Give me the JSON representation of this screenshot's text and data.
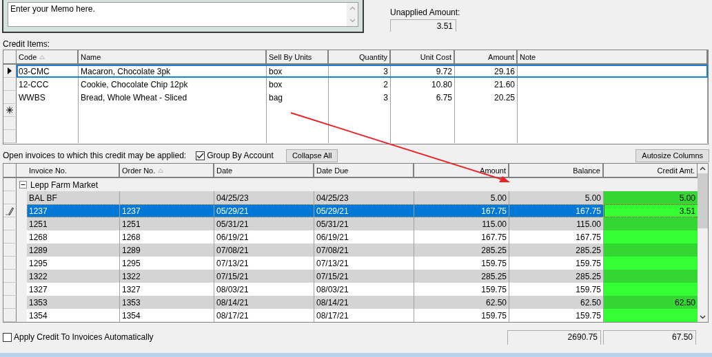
{
  "memo": {
    "placeholder": "Enter your Memo here."
  },
  "unapplied": {
    "label": "Unapplied Amount:",
    "value": "3.51"
  },
  "credit_items": {
    "label": "Credit Items:",
    "columns": [
      {
        "label": "Code",
        "sorted": true
      },
      {
        "label": "Name",
        "sorted": false
      },
      {
        "label": "Sell By Units",
        "sorted": false
      },
      {
        "label": "Quantity",
        "sorted": false
      },
      {
        "label": "Unit Cost",
        "sorted": false
      },
      {
        "label": "Amount",
        "sorted": false
      },
      {
        "label": "Note",
        "sorted": false
      }
    ],
    "rows": [
      {
        "selected": true,
        "cells": [
          "03-CMC",
          "Macaron, Chocolate 3pk",
          "box",
          "3",
          "9.72",
          "29.16",
          ""
        ]
      },
      {
        "selected": false,
        "cells": [
          "12-CCC",
          "Cookie, Chocolate Chip 12pk",
          "box",
          "2",
          "10.80",
          "21.60",
          ""
        ]
      },
      {
        "selected": false,
        "cells": [
          "WWBS",
          "Bread, Whole Wheat - Sliced",
          "bag",
          "3",
          "6.75",
          "20.25",
          ""
        ]
      }
    ]
  },
  "invoices": {
    "label": "Open invoices to which this credit may be applied:",
    "group_by_account": {
      "label": "Group By Account",
      "checked": true
    },
    "collapse_button": "Collapse All",
    "autosize_button": "Autosize Columns",
    "columns": [
      {
        "label": "Invoice No.",
        "sorted": false
      },
      {
        "label": "Order No.",
        "sorted": true
      },
      {
        "label": "Date",
        "sorted": false
      },
      {
        "label": "Date Due",
        "sorted": false
      },
      {
        "label": "Amount",
        "sorted": false
      },
      {
        "label": "Balance",
        "sorted": false
      },
      {
        "label": "Credit Amt.",
        "sorted": false
      }
    ],
    "group": {
      "label": "Lepp Farm Market",
      "expanded": true
    },
    "rows": [
      {
        "selected": false,
        "cells": [
          "BAL BF",
          "",
          "04/25/23",
          "04/25/23",
          "5.00",
          "5.00",
          "5.00"
        ]
      },
      {
        "selected": true,
        "cells": [
          "1237",
          "1237",
          "05/29/21",
          "05/29/21",
          "167.75",
          "167.75",
          "3.51"
        ]
      },
      {
        "selected": false,
        "cells": [
          "1251",
          "1251",
          "05/31/21",
          "05/31/21",
          "115.00",
          "115.00",
          ""
        ]
      },
      {
        "selected": false,
        "cells": [
          "1268",
          "1268",
          "06/19/21",
          "06/19/21",
          "167.75",
          "167.75",
          ""
        ]
      },
      {
        "selected": false,
        "cells": [
          "1289",
          "1289",
          "07/08/21",
          "07/08/21",
          "285.25",
          "285.25",
          ""
        ]
      },
      {
        "selected": false,
        "cells": [
          "1295",
          "1295",
          "07/13/21",
          "07/13/21",
          "159.75",
          "159.75",
          ""
        ]
      },
      {
        "selected": false,
        "cells": [
          "1322",
          "1322",
          "07/15/21",
          "07/15/21",
          "285.25",
          "285.25",
          ""
        ]
      },
      {
        "selected": false,
        "cells": [
          "1327",
          "1327",
          "08/03/21",
          "08/03/21",
          "159.75",
          "159.75",
          ""
        ]
      },
      {
        "selected": false,
        "cells": [
          "1353",
          "1353",
          "08/14/21",
          "08/14/21",
          "62.50",
          "62.50",
          "62.50"
        ]
      },
      {
        "selected": false,
        "cells": [
          "1354",
          "1354",
          "08/17/21",
          "08/17/21",
          "159.75",
          "159.75",
          ""
        ]
      }
    ],
    "totals": {
      "balance": "2690.75",
      "credit": "67.50"
    }
  },
  "apply_automatically": {
    "label": "Apply Credit To Invoices Automatically",
    "checked": false
  }
}
